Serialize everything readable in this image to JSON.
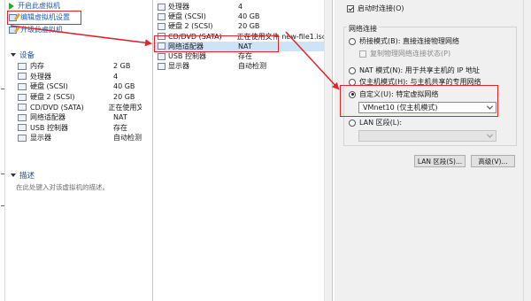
{
  "summary": {
    "actions": [
      {
        "label": "开启此虚拟机",
        "icon": "play-icon"
      },
      {
        "label": "编辑虚拟机设置",
        "icon": "edit-settings-icon"
      },
      {
        "label": "升级此虚拟机",
        "icon": "upgrade-icon"
      }
    ],
    "devices_title": "设备",
    "devices": [
      {
        "name": "内存",
        "value": "2 GB",
        "icon": "memory-icon"
      },
      {
        "name": "处理器",
        "value": "4",
        "icon": "cpu-icon"
      },
      {
        "name": "硬盘 (SCSI)",
        "value": "40 GB",
        "icon": "disk-icon"
      },
      {
        "name": "硬盘 2 (SCSI)",
        "value": "20 GB",
        "icon": "disk-icon"
      },
      {
        "name": "CD/DVD (SATA)",
        "value": "正在使用文",
        "icon": "cd-icon"
      },
      {
        "name": "网络适配器",
        "value": "NAT",
        "icon": "network-icon"
      },
      {
        "name": "USB 控制器",
        "value": "存在",
        "icon": "usb-icon"
      },
      {
        "name": "显示器",
        "value": "自动检测",
        "icon": "display-icon"
      }
    ],
    "description_title": "描述",
    "description_placeholder": "在此处键入对该虚拟机的描述。"
  },
  "device_list": {
    "rows": [
      {
        "name": "处理器",
        "value": "4",
        "icon": "cpu-icon"
      },
      {
        "name": "硬盘 (SCSI)",
        "value": "40 GB",
        "icon": "disk-icon"
      },
      {
        "name": "硬盘 2 (SCSI)",
        "value": "20 GB",
        "icon": "disk-icon"
      },
      {
        "name": "CD/DVD (SATA)",
        "value": "正在使用文件 new-file1.iso",
        "icon": "cd-icon"
      },
      {
        "name": "网络适配器",
        "value": "NAT",
        "icon": "network-icon"
      },
      {
        "name": "USB 控制器",
        "value": "存在",
        "icon": "usb-icon"
      },
      {
        "name": "显示器",
        "value": "自动检测",
        "icon": "display-icon"
      }
    ],
    "selected_index": 4
  },
  "network": {
    "connect_at_power_on": "启动时连接(O)",
    "group_title": "网络连接",
    "bridged": "桥接模式(B): 直接连接物理网络",
    "replicate_state": "复制物理网络连接状态(P)",
    "nat": "NAT 模式(N): 用于共享主机的 IP 地址",
    "host_only": "仅主机模式(H): 与主机共享的专用网络",
    "custom": "自定义(U): 特定虚拟网络",
    "custom_selected_value": "VMnet10 (仅主机模式)",
    "lan_segment": "LAN 区段(L):",
    "lan_segment_value": "",
    "lan_segments_button": "LAN 区段(S)...",
    "advanced_button": "高级(V)..."
  },
  "colors": {
    "annotation": "#e0262b",
    "link": "#1a5fb4",
    "selection": "#cde3f8"
  }
}
